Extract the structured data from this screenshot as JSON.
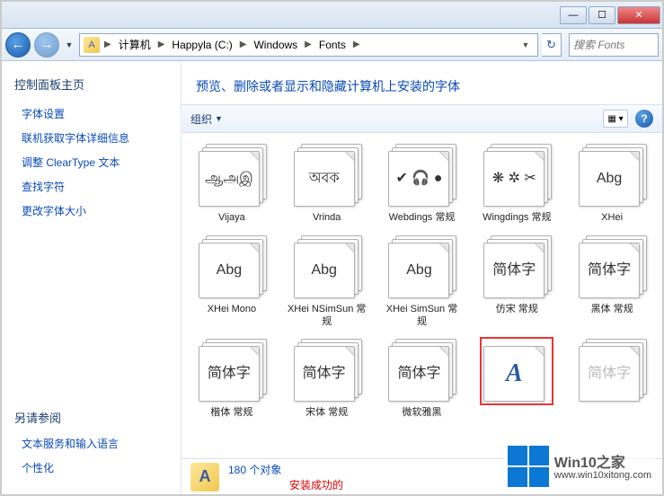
{
  "breadcrumb": [
    "计算机",
    "Happyla (C:)",
    "Windows",
    "Fonts"
  ],
  "search": {
    "placeholder": "搜索 Fonts"
  },
  "sidebar": {
    "title": "控制面板主页",
    "links": [
      "字体设置",
      "联机获取字体详细信息",
      "调整 ClearType 文本",
      "查找字符",
      "更改字体大小"
    ],
    "see_also_title": "另请参阅",
    "see_also": [
      "文本服务和输入语言",
      "个性化"
    ]
  },
  "main": {
    "title": "预览、删除或者显示和隐藏计算机上安装的字体",
    "organize": "组织"
  },
  "fonts": [
    {
      "preview": "ஆஅஇ",
      "name": "Vijaya",
      "stack": true
    },
    {
      "preview": "অবক",
      "name": "Vrinda",
      "stack": true
    },
    {
      "preview": "✔ 🎧 ●",
      "name": "Webdings 常规",
      "stack": true
    },
    {
      "preview": "❋ ✲ ✂",
      "name": "Wingdings 常规",
      "stack": true
    },
    {
      "preview": "Abg",
      "name": "XHei",
      "stack": true
    },
    {
      "preview": "Abg",
      "name": "XHei Mono",
      "stack": true
    },
    {
      "preview": "Abg",
      "name": "XHei NSimSun 常规",
      "stack": true
    },
    {
      "preview": "Abg",
      "name": "XHei SimSun 常规",
      "stack": true
    },
    {
      "preview": "简体字",
      "name": "仿宋 常规",
      "stack": true
    },
    {
      "preview": "简体字",
      "name": "黑体 常规",
      "stack": true
    },
    {
      "preview": "简体字",
      "name": "楷体 常规",
      "stack": true
    },
    {
      "preview": "简体字",
      "name": "宋体 常规",
      "stack": true
    },
    {
      "preview": "简体字",
      "name": "微软雅黑",
      "stack": true
    },
    {
      "preview": "",
      "name": "",
      "stack": false,
      "selected": true,
      "icon": "font-a"
    },
    {
      "preview": "简体字",
      "name": "",
      "stack": true,
      "partial": true
    }
  ],
  "status": {
    "count": "180 个对象",
    "message": "安装成功的"
  },
  "watermark": {
    "brand": "Win10",
    "suffix": "之家",
    "url": "www.win10xitong.com"
  }
}
